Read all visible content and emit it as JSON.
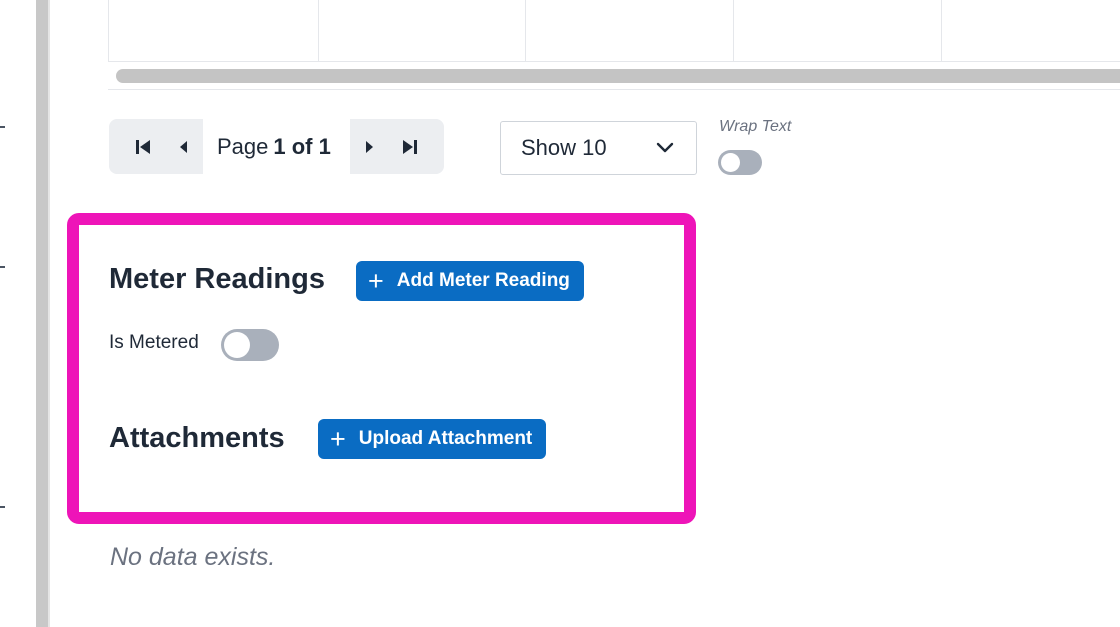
{
  "pagination": {
    "page_word": "Page",
    "page_current": "1 of 1",
    "first_icon": "skip-first-icon",
    "prev_icon": "prev-triangle-icon",
    "next_icon": "next-triangle-icon",
    "last_icon": "skip-last-icon"
  },
  "page_size": {
    "selected": "Show 10",
    "icon": "chevron-down-icon"
  },
  "wrap_text": {
    "label": "Wrap Text",
    "enabled": false
  },
  "meter_readings": {
    "title": "Meter Readings",
    "add_button_label": "Add Meter Reading",
    "add_icon": "plus-icon",
    "is_metered_label": "Is Metered",
    "is_metered": false
  },
  "attachments": {
    "title": "Attachments",
    "upload_button_label": "Upload Attachment",
    "upload_icon": "plus-icon"
  },
  "empty_state": {
    "message": "No data exists."
  },
  "colors": {
    "highlight": "#ee14b8",
    "primary": "#0a6cc3",
    "toggle_off": "#a9b0bb"
  }
}
